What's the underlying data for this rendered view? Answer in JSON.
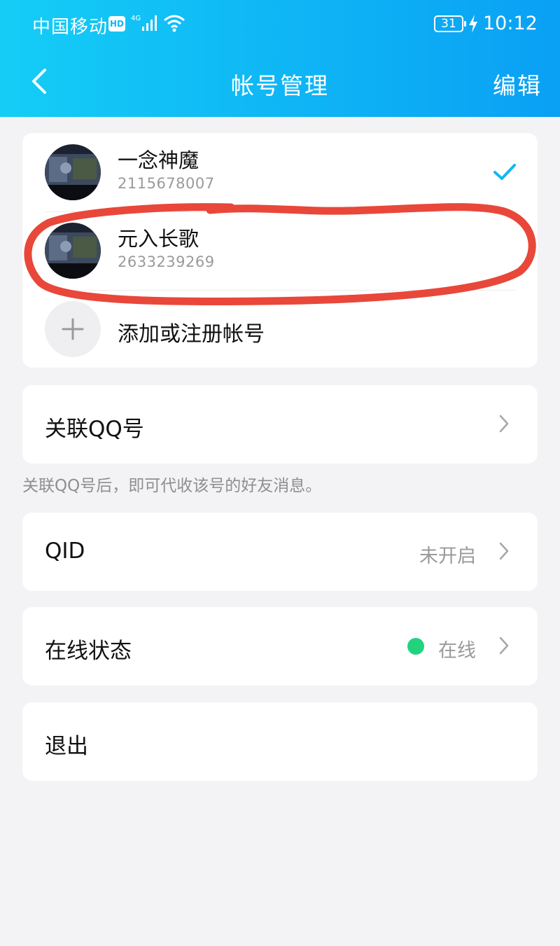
{
  "status_bar": {
    "carrier": "中国移动",
    "hd": "HD",
    "battery": "31",
    "time": "10:12"
  },
  "nav": {
    "title": "帐号管理",
    "edit_label": "编辑"
  },
  "accounts": [
    {
      "name": "一念神魔",
      "id": "2115678007",
      "selected": true
    },
    {
      "name": "元入长歌",
      "id": "2633239269",
      "selected": false
    }
  ],
  "add_account_label": "添加或注册帐号",
  "link_qq": {
    "label": "关联QQ号",
    "hint": "关联QQ号后，即可代收该号的好友消息。"
  },
  "qid": {
    "label": "QID",
    "value": "未开启"
  },
  "online_status": {
    "label": "在线状态",
    "value": "在线",
    "dot_color": "#22d37d"
  },
  "logout_label": "退出",
  "colors": {
    "header_start": "#14cdf6",
    "header_end": "#0aa0f4",
    "check": "#12b7f5",
    "annotation": "#e8473a"
  },
  "icons": [
    "back-chevron-icon",
    "check-icon",
    "plus-icon",
    "chevron-right-icon",
    "signal-icon",
    "wifi-icon",
    "charging-bolt-icon"
  ]
}
